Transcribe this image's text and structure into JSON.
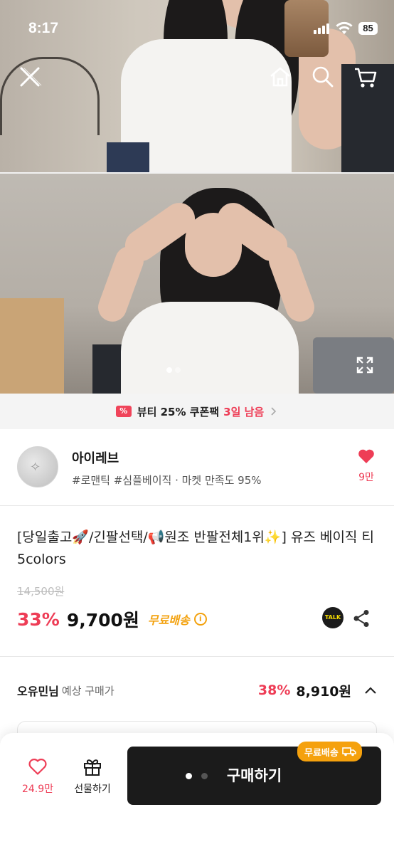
{
  "status_bar": {
    "time": "8:17",
    "battery": "85"
  },
  "nav": {
    "close_icon": "close-icon",
    "home_icon": "home-icon",
    "search_icon": "search-icon",
    "cart_icon": "cart-icon"
  },
  "coupon": {
    "badge": "%",
    "text": "뷰티 25% 쿠폰팩",
    "days_left": "3일 남음"
  },
  "shop": {
    "name": "아이레브",
    "tags": "#로맨틱 #심플베이직 · 마켓 만족도 95%",
    "likes": "9만"
  },
  "product": {
    "title": "[당일출고🚀/긴팔선택/📢원조 반팔전체1위✨] 유즈 베이직 티 5colors",
    "original_price": "14,500원",
    "discount": "33%",
    "price": "9,700원",
    "shipping": "무료배송",
    "talk_label": "TALK"
  },
  "member_price": {
    "name": "오유민님",
    "label": "예상 구매가",
    "discount": "38%",
    "price": "8,910원"
  },
  "bottom_bar": {
    "like_count": "24.9만",
    "gift_label": "선물하기",
    "buy_label": "구매하기",
    "ship_badge": "무료배송"
  },
  "colors": {
    "accent": "#ee3d56",
    "shipping": "#f3a20f",
    "buy_button": "#1b1b1b"
  }
}
